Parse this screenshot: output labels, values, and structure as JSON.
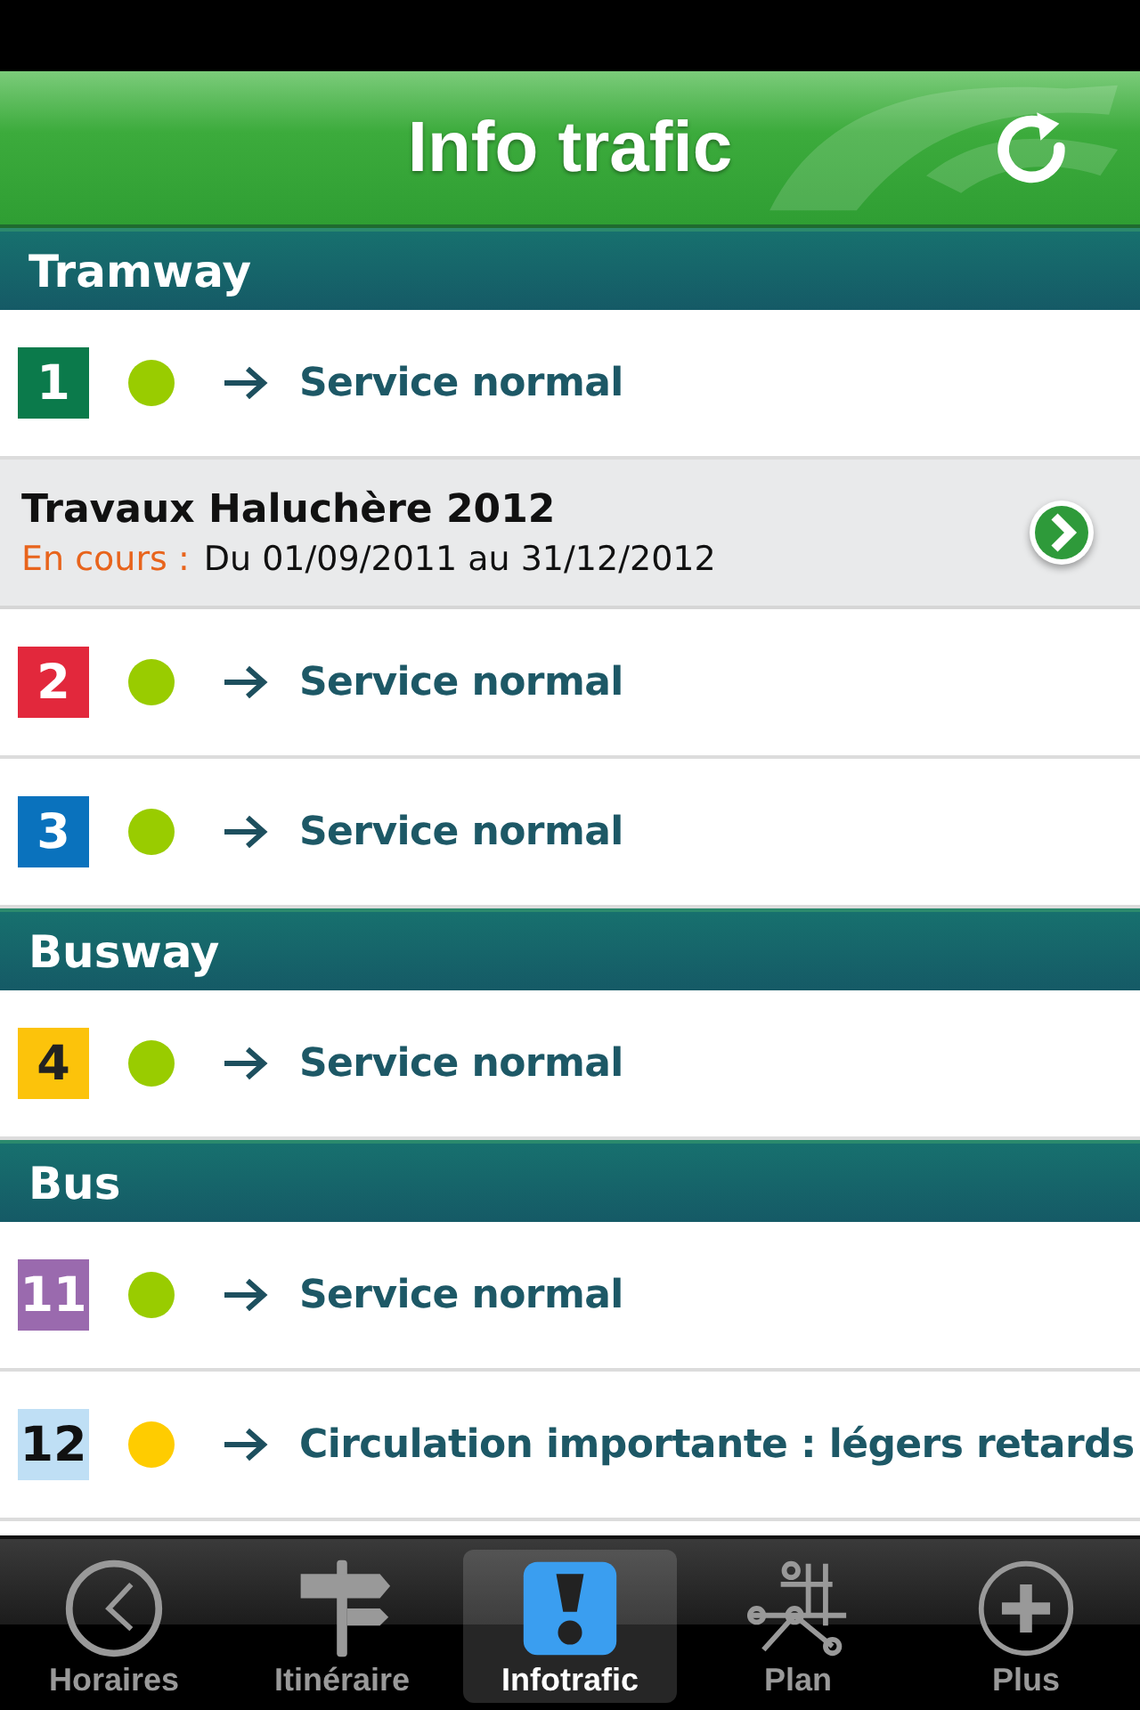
{
  "header": {
    "title": "Info trafic"
  },
  "sections": [
    {
      "title": "Tramway",
      "items": [
        {
          "kind": "line",
          "badge": {
            "label": "1",
            "color": "#0b7a4b"
          },
          "status": {
            "color": "#99cc00"
          },
          "message": "Service normal"
        },
        {
          "kind": "notice",
          "title": "Travaux Haluchère 2012",
          "state": "En cours :",
          "period": "Du 01/09/2011 au 31/12/2012"
        },
        {
          "kind": "line",
          "badge": {
            "label": "2",
            "color": "#e2283c"
          },
          "status": {
            "color": "#99cc00"
          },
          "message": "Service normal"
        },
        {
          "kind": "line",
          "badge": {
            "label": "3",
            "color": "#0a72bd"
          },
          "status": {
            "color": "#99cc00"
          },
          "message": "Service normal"
        }
      ]
    },
    {
      "title": "Busway",
      "items": [
        {
          "kind": "line",
          "badge": {
            "label": "4",
            "color": "#fcc30b"
          },
          "status": {
            "color": "#99cc00"
          },
          "message": "Service normal"
        }
      ]
    },
    {
      "title": "Bus",
      "items": [
        {
          "kind": "line",
          "badge": {
            "label": "11",
            "color": "#9a6aae"
          },
          "status": {
            "color": "#99cc00"
          },
          "message": "Service normal"
        },
        {
          "kind": "line",
          "badge": {
            "label": "12",
            "color": "#bfdff5"
          },
          "status": {
            "color": "#ffcc00"
          },
          "message": "Circulation importante : légers retards"
        }
      ]
    }
  ],
  "tabs": [
    {
      "label": "Horaires",
      "selected": false
    },
    {
      "label": "Itinéraire",
      "selected": false
    },
    {
      "label": "Infotrafic",
      "selected": true
    },
    {
      "label": "Plan",
      "selected": false
    },
    {
      "label": "Plus",
      "selected": false
    }
  ]
}
